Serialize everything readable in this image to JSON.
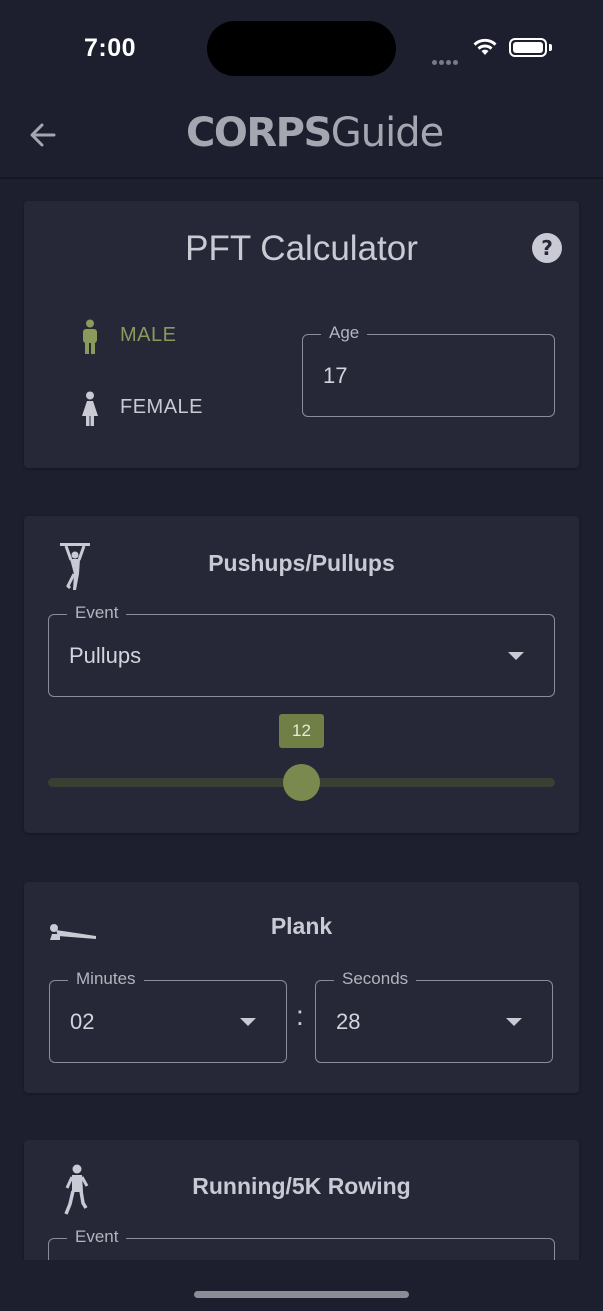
{
  "status_bar": {
    "time": "7:00"
  },
  "app_bar": {
    "logo_bold": "CORPS",
    "logo_regular": "Guide"
  },
  "calculator": {
    "title": "PFT Calculator",
    "gender_options": [
      "MALE",
      "FEMALE"
    ],
    "selected_gender": "MALE",
    "age": {
      "label": "Age",
      "value": "17"
    }
  },
  "pushups": {
    "title": "Pushups/Pullups",
    "event": {
      "label": "Event",
      "value": "Pullups"
    },
    "slider": {
      "value": "12",
      "fraction": 0.5
    }
  },
  "plank": {
    "title": "Plank",
    "minutes": {
      "label": "Minutes",
      "value": "02"
    },
    "separator": ":",
    "seconds": {
      "label": "Seconds",
      "value": "28"
    }
  },
  "running": {
    "title": "Running/5K Rowing",
    "event": {
      "label": "Event"
    }
  },
  "colors": {
    "background": "#1e1f2e",
    "card": "#262837",
    "accent_green": "#8a9a5b",
    "slider_track": "#3a3f34"
  },
  "icons": [
    "back-arrow-icon",
    "help-icon",
    "male-icon",
    "female-icon",
    "pullup-figure-icon",
    "plank-figure-icon",
    "runner-figure-icon",
    "dropdown-caret-icon",
    "wifi-icon",
    "battery-icon"
  ]
}
